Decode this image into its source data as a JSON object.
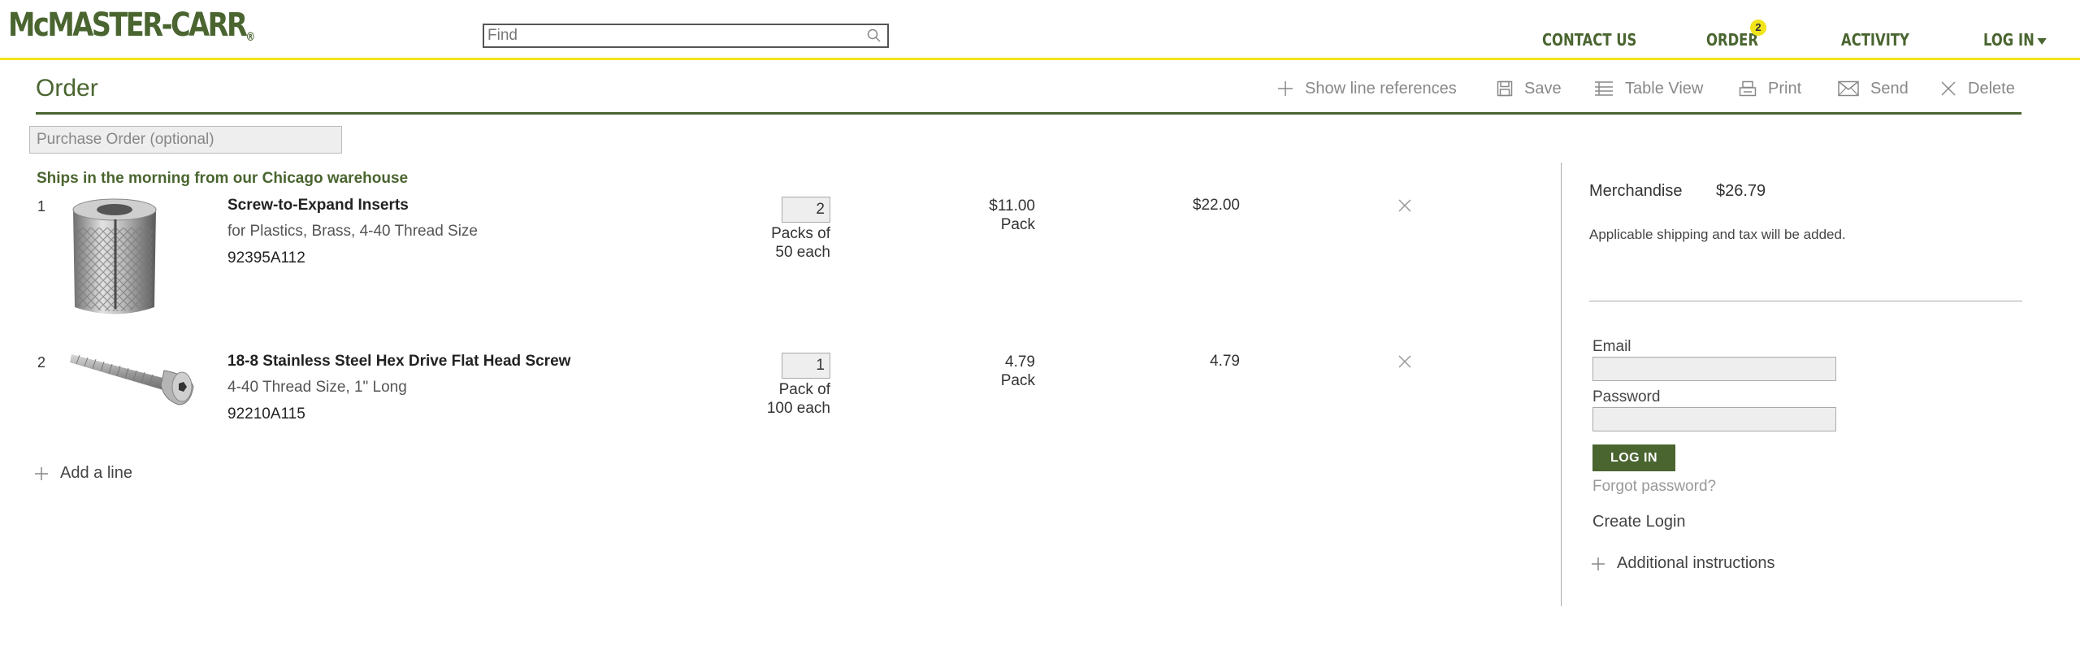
{
  "header": {
    "logo": "McMASTER-CARR",
    "logo_mark": "®",
    "search": {
      "placeholder": "Find",
      "value": ""
    },
    "nav": {
      "contact": "CONTACT US",
      "order": "ORDER",
      "order_count": "2",
      "activity": "ACTIVITY",
      "login": "LOG IN"
    }
  },
  "order": {
    "title": "Order",
    "toolbar": {
      "show_refs": "Show line references",
      "save": "Save",
      "table_view": "Table View",
      "print": "Print",
      "send": "Send",
      "delete": "Delete"
    },
    "po_placeholder": "Purchase Order (optional)",
    "ships_note": "Ships in the morning from our Chicago warehouse",
    "lines": [
      {
        "num": "1",
        "name": "Screw-to-Expand Inserts",
        "desc": "for Plastics, Brass, 4-40 Thread Size",
        "part": "92395A112",
        "qty": "2",
        "pack_note_1": "Packs of",
        "pack_note_2": "50 each",
        "unit_price": "$11.00",
        "unit": "Pack",
        "total": "$22.00",
        "image_icon": "threaded-insert-image"
      },
      {
        "num": "2",
        "name": "18-8 Stainless Steel Hex Drive Flat Head Screw",
        "desc": "4-40 Thread Size, 1\" Long",
        "part": "92210A115",
        "qty": "1",
        "pack_note_1": "Pack of",
        "pack_note_2": "100 each",
        "unit_price": "4.79",
        "unit": "Pack",
        "total": "4.79",
        "image_icon": "flat-head-screw-image"
      }
    ],
    "add_line": "Add a line"
  },
  "summary": {
    "merch_label": "Merchandise",
    "merch_value": "$26.79",
    "shipping_note": "Applicable shipping and tax will be added.",
    "email_label": "Email",
    "password_label": "Password",
    "login_button": "LOG IN",
    "forgot": "Forgot password?",
    "create": "Create Login",
    "additional": "Additional instructions"
  },
  "colors": {
    "brand_green": "#4a6530",
    "accent_yellow": "#f2e41b"
  }
}
